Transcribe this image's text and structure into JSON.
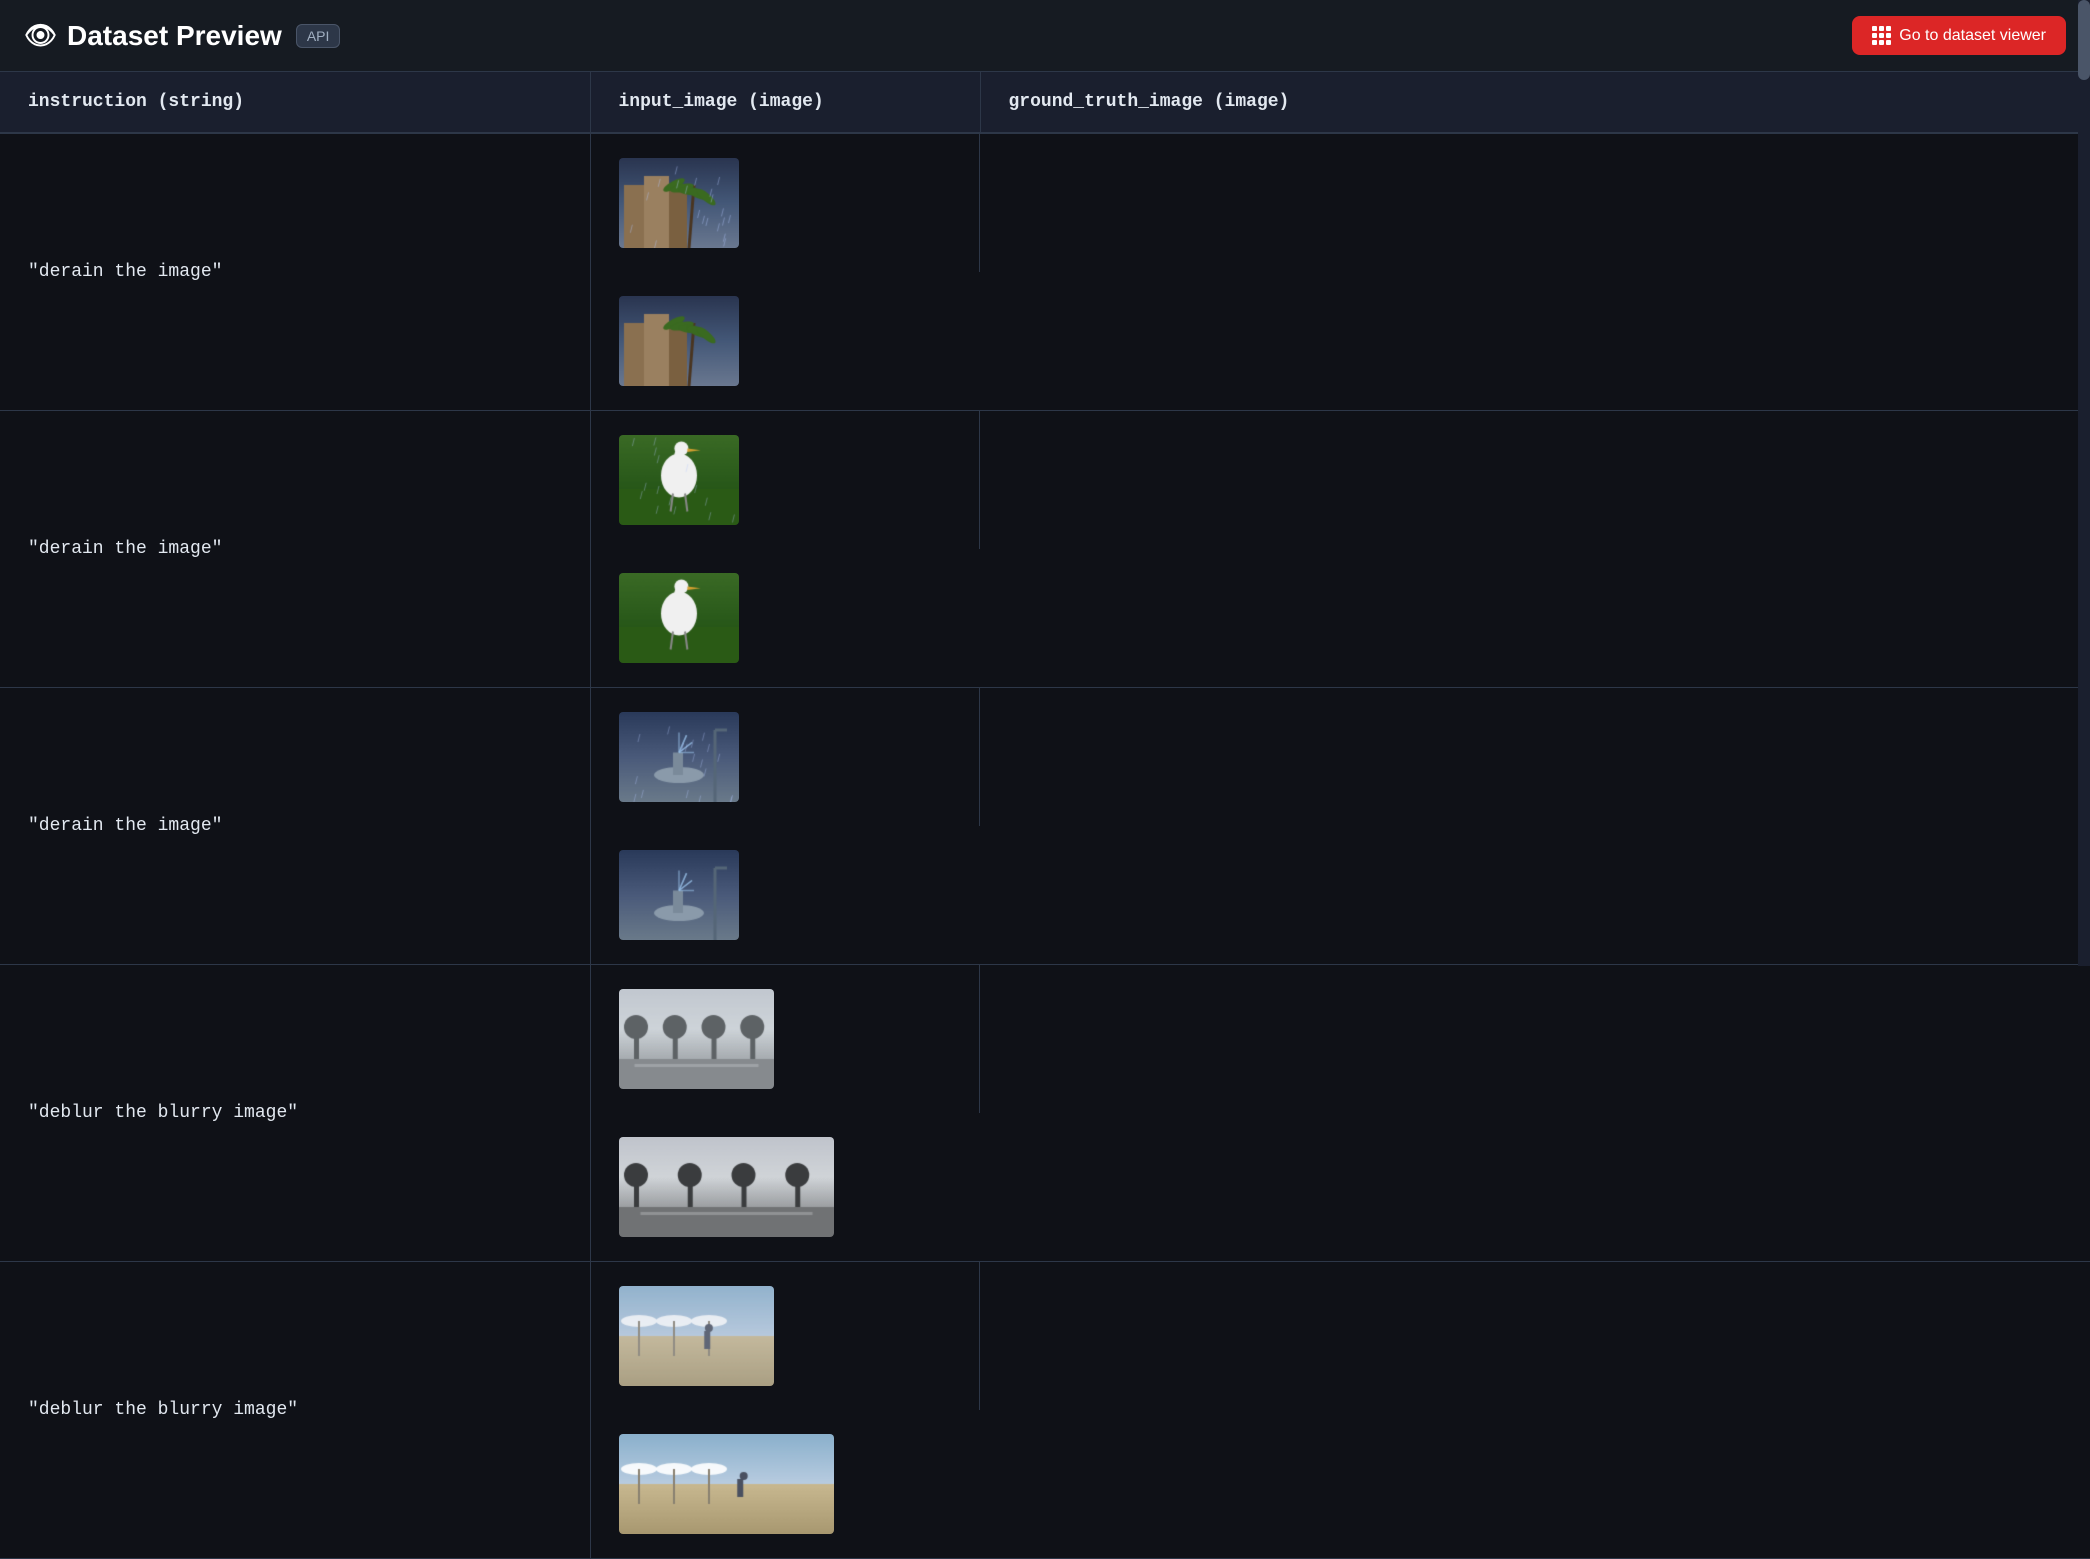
{
  "header": {
    "title": "Dataset Preview",
    "title_icon": "👁",
    "api_label": "API",
    "viewer_button_label": "Go to dataset viewer"
  },
  "table": {
    "columns": [
      {
        "id": "instruction",
        "label": "instruction (string)"
      },
      {
        "id": "input_image",
        "label": "input_image (image)"
      },
      {
        "id": "ground_truth_image",
        "label": "ground_truth_image (image)"
      }
    ],
    "rows": [
      {
        "instruction": "\"derain the image\"",
        "input_img_desc": "rainy city with palm trees",
        "ground_img_desc": "clear city with palm trees"
      },
      {
        "instruction": "\"derain the image\"",
        "input_img_desc": "rainy scene with white bird in grass",
        "ground_img_desc": "clear scene with white bird in grass"
      },
      {
        "instruction": "\"derain the image\"",
        "input_img_desc": "rainy outdoor fountain scene",
        "ground_img_desc": "clear outdoor fountain scene"
      },
      {
        "instruction": "\"deblur the blurry image\"",
        "input_img_desc": "blurry street with trees",
        "ground_img_desc": "clear street with trees"
      },
      {
        "instruction": "\"deblur the blurry image\"",
        "input_img_desc": "blurry outdoor walkway",
        "ground_img_desc": "clear outdoor walkway"
      }
    ]
  },
  "colors": {
    "background": "#0f1117",
    "header_bg": "#161b22",
    "cell_bg": "#13171f",
    "border": "#2d3748",
    "text": "#e2e8f0",
    "muted": "#a0aec0",
    "accent_red": "#dc2626",
    "api_bg": "#2d3748"
  }
}
